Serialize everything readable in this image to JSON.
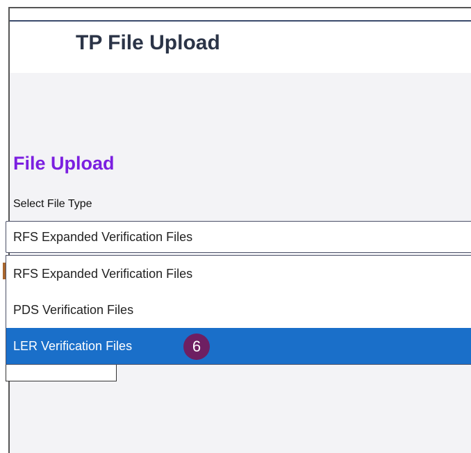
{
  "header": {
    "title": "TP File Upload"
  },
  "section": {
    "title": "File Upload",
    "field_label": "Select File Type"
  },
  "select": {
    "value": "RFS Expanded Verification Files"
  },
  "dropdown": {
    "options": [
      {
        "label": "RFS Expanded Verification Files"
      },
      {
        "label": "PDS Verification Files"
      },
      {
        "label": "LER Verification Files"
      }
    ],
    "selected_index": 2
  },
  "annotation": {
    "step": "6"
  },
  "colors": {
    "title": "#2b3447",
    "section_title": "#7b1fe0",
    "selected_bg": "#1a6fc9",
    "badge_bg": "#6e1f62"
  }
}
